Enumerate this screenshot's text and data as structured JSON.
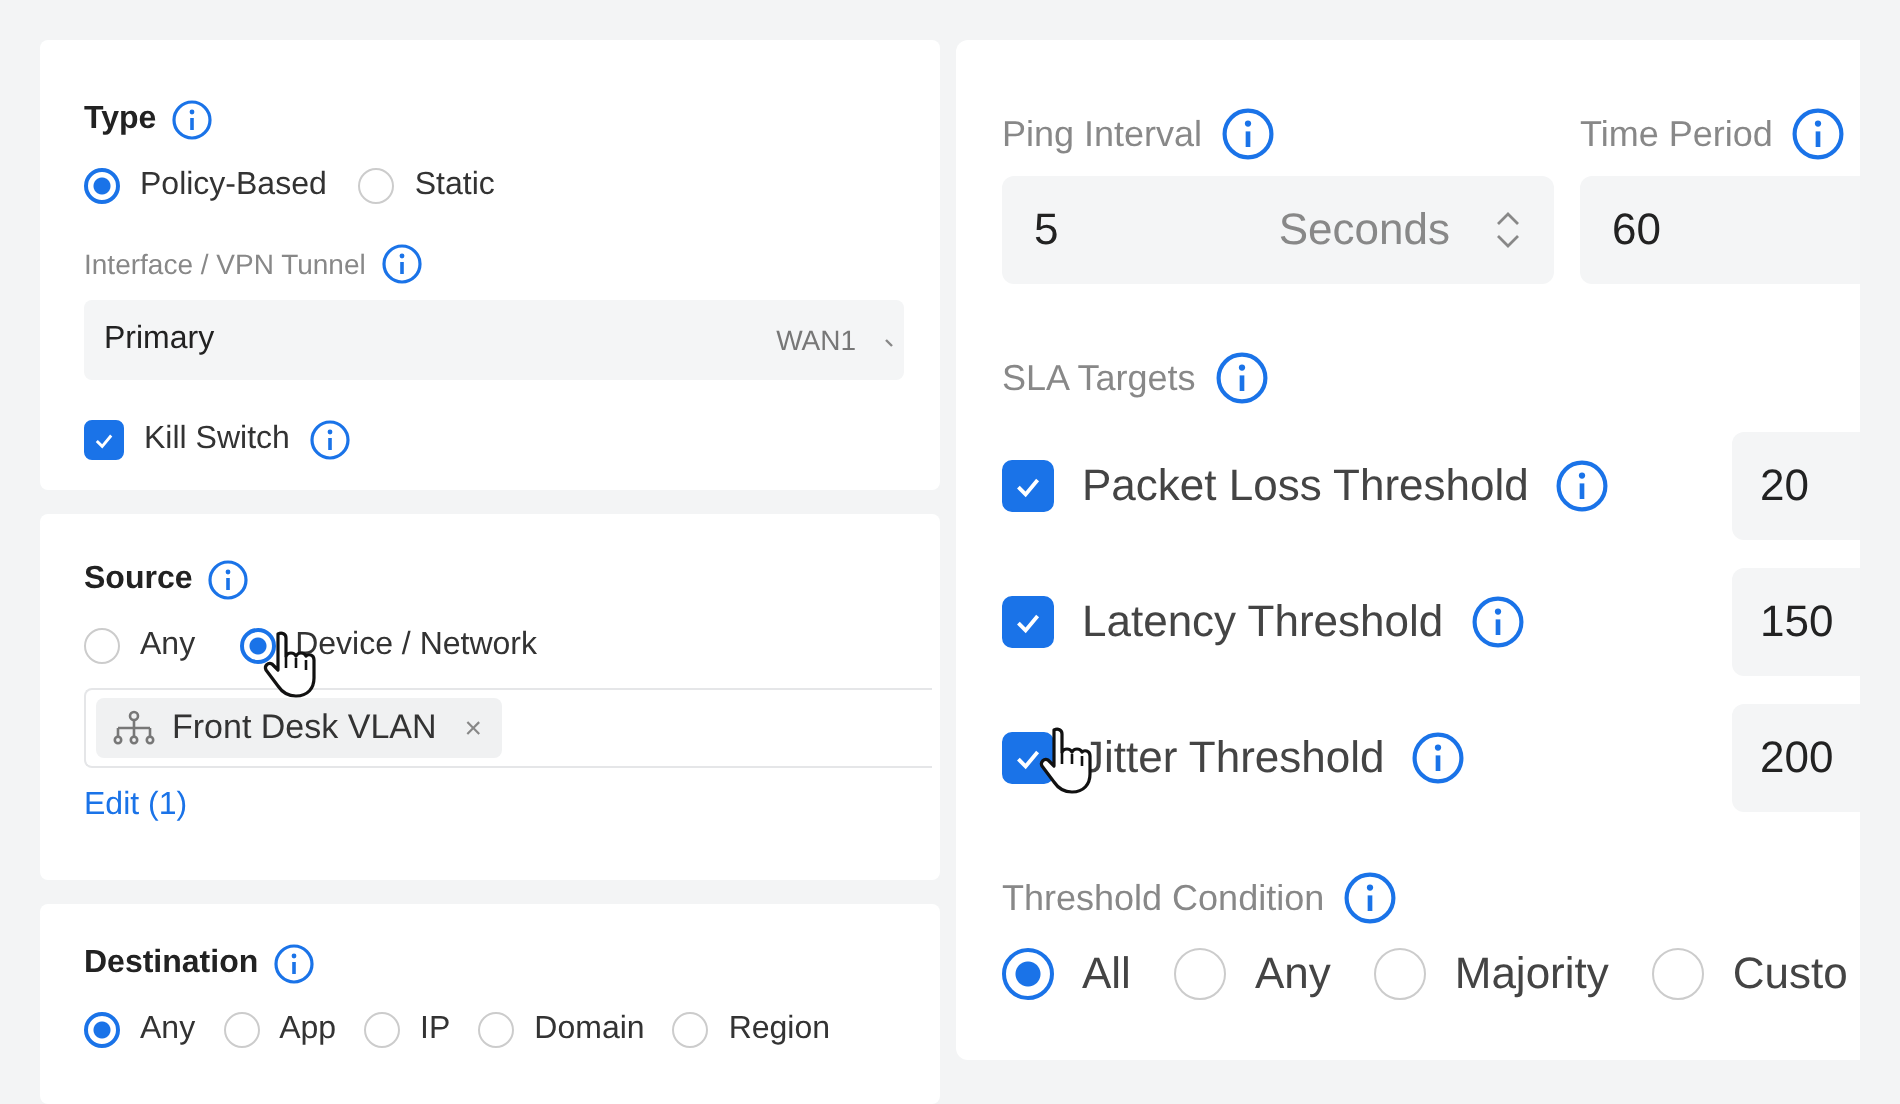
{
  "type_section": {
    "title": "Type",
    "options": [
      {
        "label": "Policy-Based",
        "selected": true
      },
      {
        "label": "Static",
        "selected": false
      }
    ],
    "interface_label": "Interface / VPN Tunnel",
    "interface_value": "Primary",
    "interface_detail": "WAN1",
    "kill_switch": {
      "label": "Kill Switch",
      "checked": true
    }
  },
  "source_section": {
    "title": "Source",
    "options": [
      {
        "label": "Any",
        "selected": false
      },
      {
        "label": "Device / Network",
        "selected": true
      }
    ],
    "chips": [
      {
        "label": "Front Desk VLAN",
        "remove": "×"
      }
    ],
    "edit_link": "Edit (1)"
  },
  "destination_section": {
    "title": "Destination",
    "options": [
      {
        "label": "Any",
        "selected": true
      },
      {
        "label": "App",
        "selected": false
      },
      {
        "label": "IP",
        "selected": false
      },
      {
        "label": "Domain",
        "selected": false
      },
      {
        "label": "Region",
        "selected": false
      }
    ]
  },
  "monitor": {
    "ping_interval": {
      "label": "Ping Interval",
      "value": "5",
      "unit": "Seconds"
    },
    "time_period": {
      "label": "Time Period",
      "value": "60"
    },
    "sla_label": "SLA Targets",
    "targets": [
      {
        "label": "Packet Loss Threshold",
        "checked": true,
        "value": "20"
      },
      {
        "label": "Latency Threshold",
        "checked": true,
        "value": "150"
      },
      {
        "label": "Jitter Threshold",
        "checked": true,
        "value": "200"
      }
    ],
    "condition_label": "Threshold Condition",
    "conditions": [
      {
        "label": "All",
        "selected": true
      },
      {
        "label": "Any",
        "selected": false
      },
      {
        "label": "Majority",
        "selected": false
      },
      {
        "label": "Custo",
        "selected": false
      }
    ]
  }
}
